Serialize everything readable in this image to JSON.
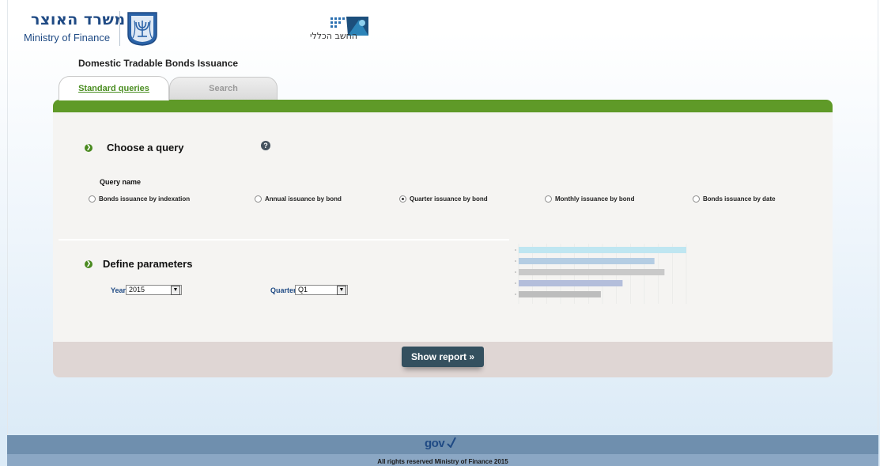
{
  "header": {
    "ministry_hebrew": "משרד האוצר",
    "ministry_english": "Ministry of Finance",
    "accountant_general_hebrew": "החשב הכללי"
  },
  "page_title": "Domestic Tradable Bonds Issuance",
  "tabs": [
    {
      "label": "Standard queries",
      "active": true
    },
    {
      "label": "Search",
      "active": false
    }
  ],
  "choose_query": {
    "heading": "Choose a query",
    "help_icon": "?",
    "query_name_label": "Query name",
    "options": [
      {
        "label": "Bonds issuance by indexation",
        "selected": false
      },
      {
        "label": "Annual issuance by bond",
        "selected": false
      },
      {
        "label": "Quarter issuance by bond",
        "selected": true
      },
      {
        "label": "Monthly issuance by bond",
        "selected": false
      },
      {
        "label": "Bonds issuance by date",
        "selected": false
      }
    ]
  },
  "define_parameters": {
    "heading": "Define parameters",
    "year_label": "Year",
    "year_value": "2015",
    "quarter_label": "Quarter",
    "quarter_value": "Q1"
  },
  "preview_chart_values": [
    1.0,
    0.81,
    0.87,
    0.62,
    0.49
  ],
  "show_report_label": "Show report »",
  "footer": {
    "gov_logo": "gov",
    "copyright": "All rights reserved Ministry of Finance 2015"
  },
  "colors": {
    "brand_green": "#5f9a28",
    "brand_blue": "#1f4a84",
    "button": "#34505f",
    "footer": "#6f8fae"
  }
}
